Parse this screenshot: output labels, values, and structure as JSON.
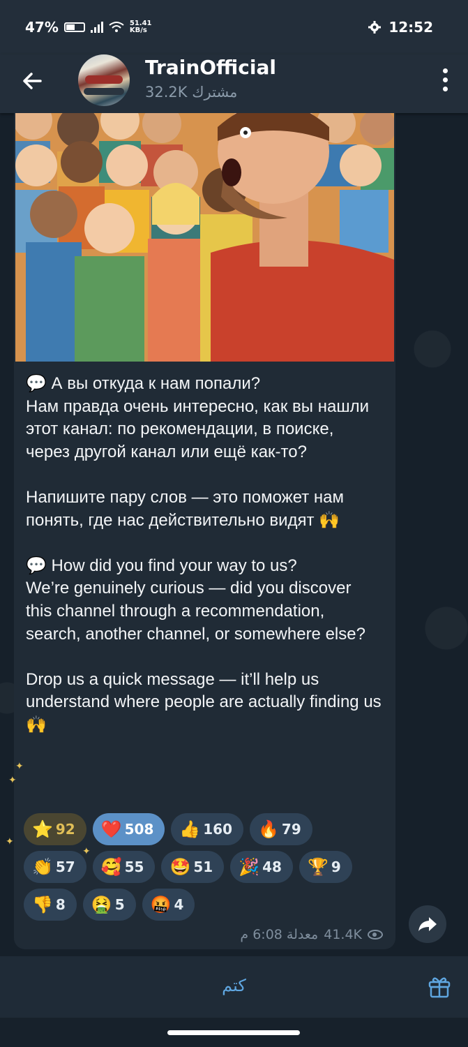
{
  "status_bar": {
    "battery": "47%",
    "net_speed_value": "51.41",
    "net_speed_unit": "KB/s",
    "time": "12:52"
  },
  "header": {
    "channel_name": "TrainOfficial",
    "subscribers": "32.2K مشترك"
  },
  "message": {
    "text": "💬 А вы откуда к нам попали?\nНам правда очень интересно, как вы нашли этот канал: по рекомендации, в поиске, через другой канал или ещё как-то?\n\nНапишите пару слов — это поможет нам понять, где нас действительно видят 🙌\n\n💬 How did you find your way to us?\nWe’re genuinely curious — did you discover this channel through a recommendation, search, another channel, or somewhere else?\n\nDrop us a quick message — it’ll help us understand where people are actually finding us 🙌",
    "views": "41.4K",
    "time_edited": "معدلة 6:08 م"
  },
  "reactions": [
    {
      "emoji": "⭐",
      "count": "92"
    },
    {
      "emoji": "❤️",
      "count": "508"
    },
    {
      "emoji": "👍",
      "count": "160"
    },
    {
      "emoji": "🔥",
      "count": "79"
    },
    {
      "emoji": "👏",
      "count": "57"
    },
    {
      "emoji": "🥰",
      "count": "55"
    },
    {
      "emoji": "🤩",
      "count": "51"
    },
    {
      "emoji": "🎉",
      "count": "48"
    },
    {
      "emoji": "🏆",
      "count": "9"
    },
    {
      "emoji": "👎",
      "count": "8"
    },
    {
      "emoji": "🤮",
      "count": "5"
    },
    {
      "emoji": "🤬",
      "count": "4"
    }
  ],
  "bottom_bar": {
    "mute_label": "كتم"
  },
  "colors": {
    "accent": "#5fa6e0",
    "bubble": "#202b36",
    "header": "#232e3a"
  },
  "icons": [
    "back-arrow-icon",
    "more-vert-icon",
    "gear-icon",
    "eye-icon",
    "share-icon",
    "gift-icon"
  ]
}
